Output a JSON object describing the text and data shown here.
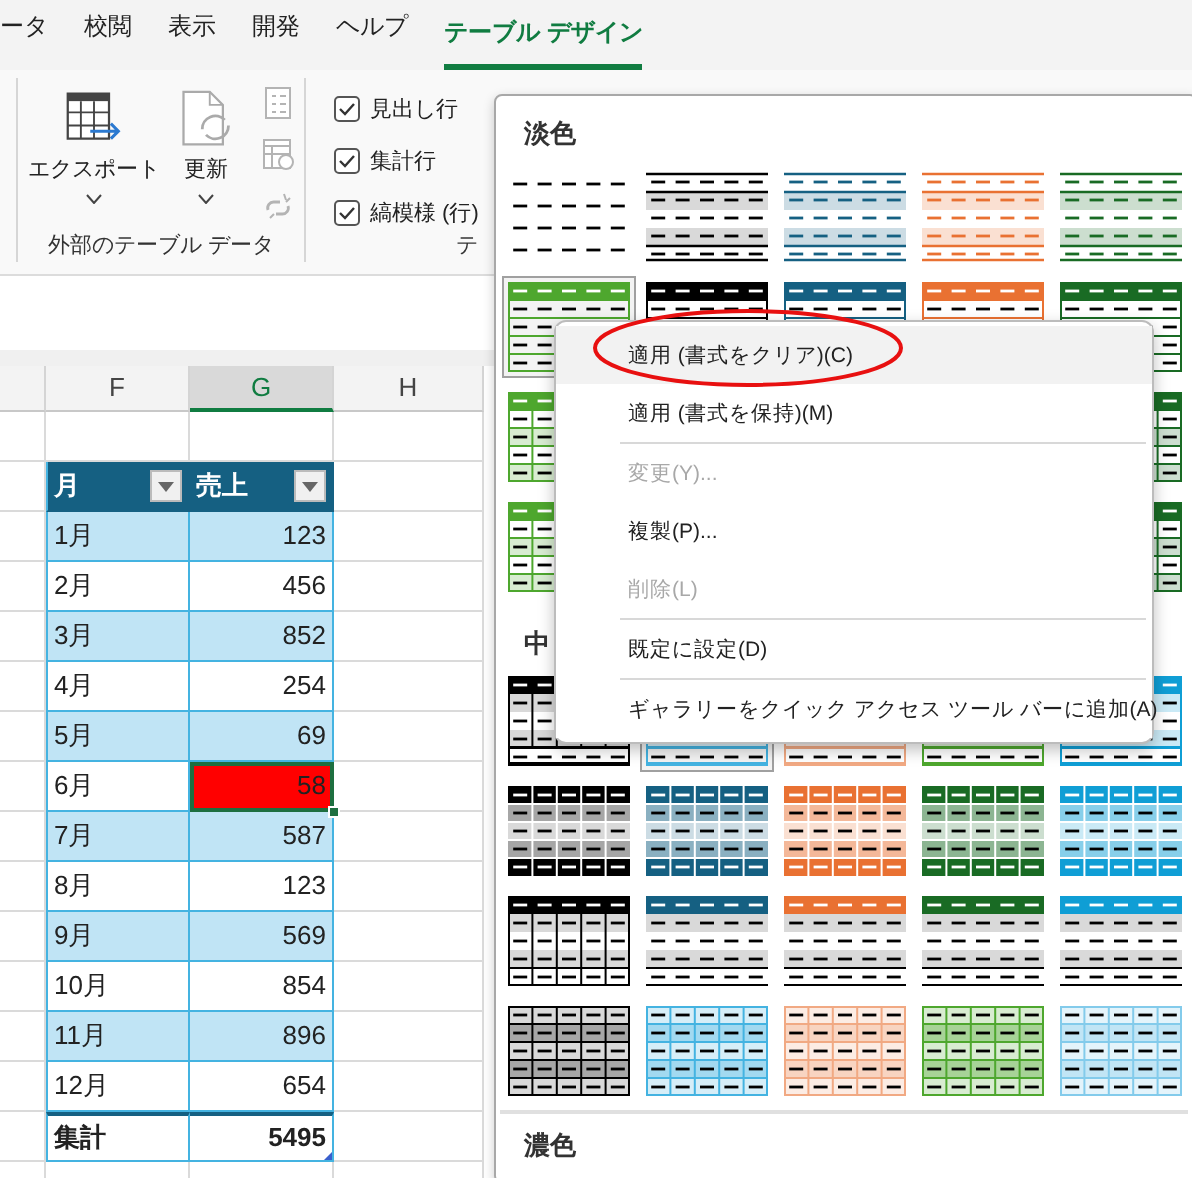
{
  "ribbon_tabs": [
    {
      "label": "ータ",
      "selected": false
    },
    {
      "label": "校閲",
      "selected": false
    },
    {
      "label": "表示",
      "selected": false
    },
    {
      "label": "開発",
      "selected": false
    },
    {
      "label": "ヘルプ",
      "selected": false
    },
    {
      "label": "テーブル デザイン",
      "selected": true
    }
  ],
  "ribbon": {
    "groups": [
      {
        "label": "外部のテーブル データ",
        "large_buttons": [
          {
            "kind": "export",
            "label": "エクスポート",
            "dropdown": true
          },
          {
            "kind": "refresh",
            "label": "更新",
            "dropdown": true
          }
        ],
        "small_buttons": [
          {
            "kind": "properties",
            "disabled": true
          },
          {
            "kind": "browser",
            "disabled": true
          },
          {
            "kind": "unlink",
            "disabled": true
          }
        ]
      },
      {
        "label": "テ",
        "checkboxes": [
          {
            "label": "見出し行",
            "checked": true
          },
          {
            "label": "集計行",
            "checked": true
          },
          {
            "label": "縞模様 (行)",
            "checked": true
          }
        ]
      }
    ]
  },
  "sheet": {
    "columns": [
      {
        "label": "F",
        "selected": false
      },
      {
        "label": "G",
        "selected": true
      },
      {
        "label": "H",
        "selected": false
      }
    ],
    "table": {
      "headers": [
        "月",
        "売上"
      ],
      "rows": [
        {
          "month": "1月",
          "sales": "123",
          "selected": false
        },
        {
          "month": "2月",
          "sales": "456",
          "selected": false
        },
        {
          "month": "3月",
          "sales": "852",
          "selected": false
        },
        {
          "month": "4月",
          "sales": "254",
          "selected": false
        },
        {
          "month": "5月",
          "sales": "69",
          "selected": false
        },
        {
          "month": "6月",
          "sales": "58",
          "selected": true,
          "color": "#ff0000"
        },
        {
          "month": "7月",
          "sales": "587",
          "selected": false
        },
        {
          "month": "8月",
          "sales": "123",
          "selected": false
        },
        {
          "month": "9月",
          "sales": "569",
          "selected": false
        },
        {
          "month": "10月",
          "sales": "854",
          "selected": false
        },
        {
          "month": "11月",
          "sales": "896",
          "selected": false
        },
        {
          "month": "12月",
          "sales": "654",
          "selected": false
        }
      ],
      "total": {
        "label": "集計",
        "value": "5495"
      }
    }
  },
  "style_gallery": {
    "sections": [
      {
        "title": "淡色",
        "rows": [
          {
            "kind": "light-banded",
            "styles": [
              {
                "kind": "plain",
                "color": "#000000",
                "selected": false
              },
              {
                "color": "#000000",
                "selected": false
              },
              {
                "color": "#156082",
                "selected": false
              },
              {
                "color": "#e97132",
                "selected": false
              },
              {
                "color": "#196b24",
                "selected": false
              }
            ]
          },
          {
            "kind": "light-header",
            "styles": [
              {
                "color": "#4ea72e",
                "selected": true
              },
              {
                "color": "#000000",
                "selected": false
              },
              {
                "color": "#156082",
                "selected": false
              },
              {
                "color": "#e97132",
                "selected": false
              },
              {
                "color": "#196b24",
                "selected": false
              }
            ]
          },
          {
            "kind": "light-grid",
            "styles": [
              {
                "color": "#4ea72e",
                "selected": false
              },
              {
                "color": "#196b24",
                "selected": false
              }
            ]
          },
          {
            "kind": "light-grid",
            "styles": [
              {
                "color": "#4ea72e",
                "selected": false
              },
              {
                "color": "#196b24",
                "selected": false
              }
            ]
          }
        ]
      },
      {
        "title": "中",
        "rows": [
          {
            "kind": "medium-banded",
            "styles": [
              {
                "color": "#000000",
                "selected": false
              },
              {
                "color": "#44b3e1",
                "selected": true
              },
              {
                "color": "#f1a983",
                "selected": false
              },
              {
                "color": "#4ea72e",
                "selected": false
              },
              {
                "color": "#0f9ed5",
                "selected": false
              }
            ]
          },
          {
            "kind": "medium-full",
            "styles": [
              {
                "color": "#000000",
                "selected": false
              },
              {
                "color": "#156082",
                "selected": false
              },
              {
                "color": "#e97132",
                "selected": false
              },
              {
                "color": "#196b24",
                "selected": false
              },
              {
                "color": "#0f9ed5",
                "selected": false
              }
            ]
          },
          {
            "kind": "medium-header",
            "styles": [
              {
                "color": "#000000",
                "selected": false
              },
              {
                "color": "#156082",
                "selected": false
              },
              {
                "color": "#e97132",
                "selected": false
              },
              {
                "color": "#196b24",
                "selected": false
              },
              {
                "color": "#0f9ed5",
                "selected": false
              }
            ]
          },
          {
            "kind": "medium-grid",
            "styles": [
              {
                "color": "#000000",
                "selected": false
              },
              {
                "color": "#44b3e1",
                "selected": false
              },
              {
                "color": "#f1a983",
                "selected": false
              },
              {
                "color": "#4ea72e",
                "selected": false
              },
              {
                "color": "#83cbeb",
                "selected": false
              }
            ]
          }
        ]
      },
      {
        "title": "濃色"
      }
    ]
  },
  "context_menu": {
    "items": [
      {
        "kind": "item",
        "label": "適用 (書式をクリア)(C)",
        "disabled": false,
        "selected": true,
        "circled": true
      },
      {
        "kind": "item",
        "label": "適用 (書式を保持)(M)",
        "disabled": false,
        "selected": false,
        "circled": false
      },
      {
        "kind": "separator"
      },
      {
        "kind": "item",
        "label": "変更(Y)...",
        "disabled": true,
        "selected": false,
        "circled": false
      },
      {
        "kind": "item",
        "label": "複製(P)...",
        "disabled": false,
        "selected": false,
        "circled": false
      },
      {
        "kind": "item",
        "label": "削除(L)",
        "disabled": true,
        "selected": false,
        "circled": false
      },
      {
        "kind": "separator"
      },
      {
        "kind": "item",
        "label": "既定に設定(D)",
        "disabled": false,
        "selected": false,
        "circled": false
      },
      {
        "kind": "separator"
      },
      {
        "kind": "item",
        "label": "ギャラリーをクイック アクセス ツール バーに追加(A)",
        "disabled": false,
        "selected": false,
        "circled": false
      }
    ]
  }
}
